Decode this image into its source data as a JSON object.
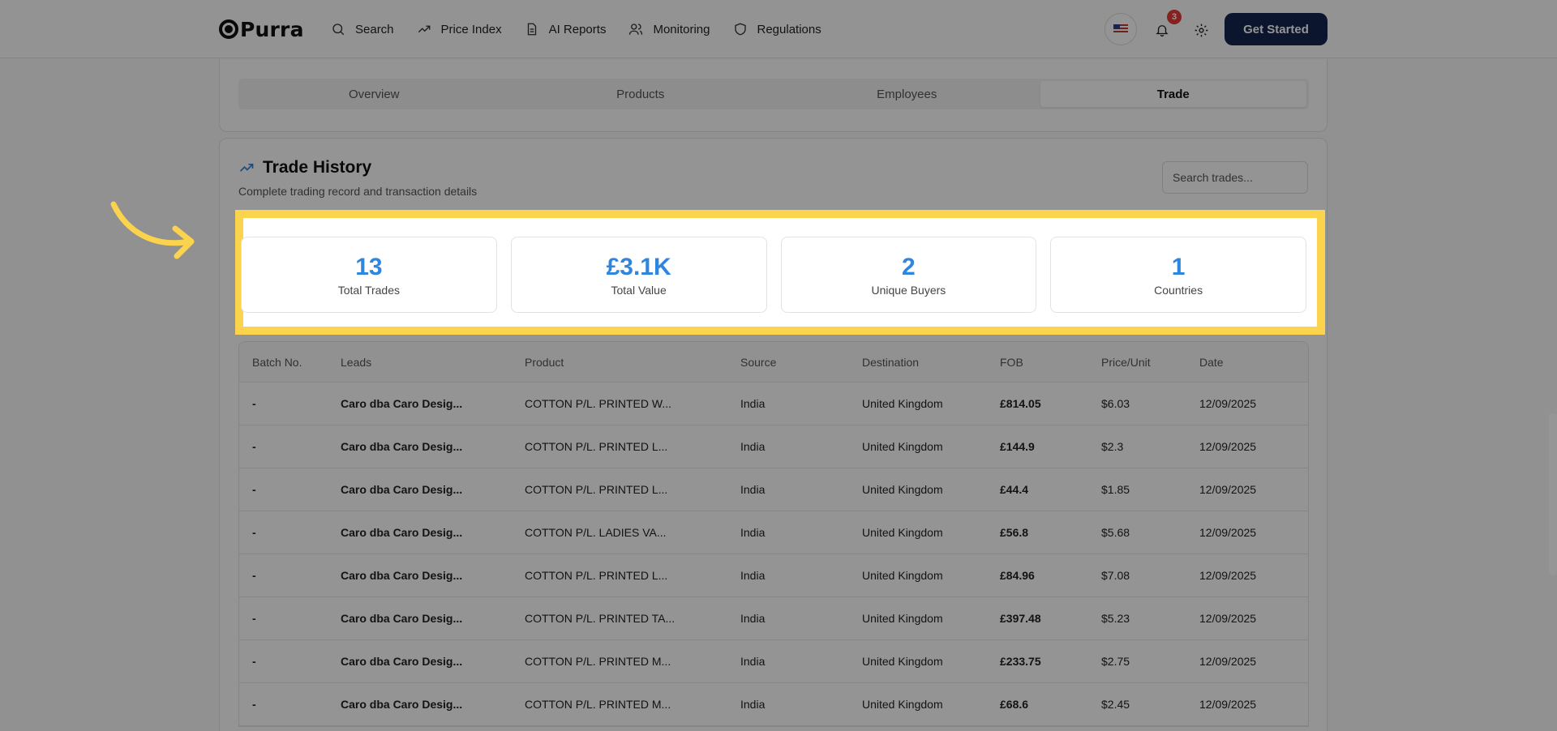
{
  "brand": {
    "name": "Purra"
  },
  "nav": [
    {
      "label": "Search",
      "icon": "search-icon"
    },
    {
      "label": "Price Index",
      "icon": "trending-up-icon"
    },
    {
      "label": "AI Reports",
      "icon": "document-icon"
    },
    {
      "label": "Monitoring",
      "icon": "users-icon"
    },
    {
      "label": "Regulations",
      "icon": "shield-icon"
    }
  ],
  "header": {
    "notification_count": "3",
    "cta_label": "Get Started"
  },
  "tabs": [
    {
      "label": "Overview",
      "active": false
    },
    {
      "label": "Products",
      "active": false
    },
    {
      "label": "Employees",
      "active": false
    },
    {
      "label": "Trade",
      "active": true
    }
  ],
  "trade_history": {
    "title": "Trade History",
    "subtitle": "Complete trading record and transaction details",
    "search_placeholder": "Search trades..."
  },
  "stats": [
    {
      "value": "13",
      "label": "Total Trades"
    },
    {
      "value": "£3.1K",
      "label": "Total Value"
    },
    {
      "value": "2",
      "label": "Unique Buyers"
    },
    {
      "value": "1",
      "label": "Countries"
    }
  ],
  "table": {
    "headers": [
      "Batch No.",
      "Leads",
      "Product",
      "Source",
      "Destination",
      "FOB",
      "Price/Unit",
      "Date"
    ],
    "rows": [
      [
        "-",
        "Caro dba Caro Desig...",
        "COTTON P/L. PRINTED W...",
        "India",
        "United Kingdom",
        "£814.05",
        "$6.03",
        "12/09/2025"
      ],
      [
        "-",
        "Caro dba Caro Desig...",
        "COTTON P/L. PRINTED L...",
        "India",
        "United Kingdom",
        "£144.9",
        "$2.3",
        "12/09/2025"
      ],
      [
        "-",
        "Caro dba Caro Desig...",
        "COTTON P/L. PRINTED L...",
        "India",
        "United Kingdom",
        "£44.4",
        "$1.85",
        "12/09/2025"
      ],
      [
        "-",
        "Caro dba Caro Desig...",
        "COTTON P/L. LADIES VA...",
        "India",
        "United Kingdom",
        "£56.8",
        "$5.68",
        "12/09/2025"
      ],
      [
        "-",
        "Caro dba Caro Desig...",
        "COTTON P/L. PRINTED L...",
        "India",
        "United Kingdom",
        "£84.96",
        "$7.08",
        "12/09/2025"
      ],
      [
        "-",
        "Caro dba Caro Desig...",
        "COTTON P/L. PRINTED TA...",
        "India",
        "United Kingdom",
        "£397.48",
        "$5.23",
        "12/09/2025"
      ],
      [
        "-",
        "Caro dba Caro Desig...",
        "COTTON P/L. PRINTED M...",
        "India",
        "United Kingdom",
        "£233.75",
        "$2.75",
        "12/09/2025"
      ],
      [
        "-",
        "Caro dba Caro Desig...",
        "COTTON P/L. PRINTED M...",
        "India",
        "United Kingdom",
        "£68.6",
        "$2.45",
        "12/09/2025"
      ]
    ]
  },
  "colors": {
    "accent": "#2e86de",
    "highlight": "#fcd34d",
    "cta": "#152550",
    "badge": "#e53935"
  }
}
